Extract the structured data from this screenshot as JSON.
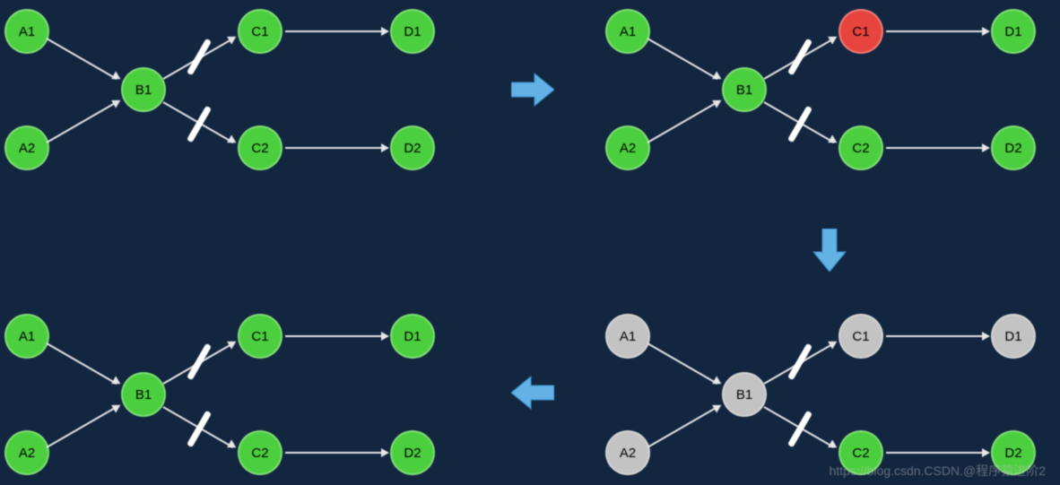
{
  "colors": {
    "green": "#4CCF3E",
    "red": "#E8443E",
    "gray": "#C3C3C3",
    "bg": "#122640",
    "arrow_blue": "#62B2E6"
  },
  "graphs": [
    {
      "id": "top-left",
      "nodes": {
        "A1": "green",
        "A2": "green",
        "B1": "green",
        "C1": "green",
        "C2": "green",
        "D1": "green",
        "D2": "green"
      }
    },
    {
      "id": "top-right",
      "nodes": {
        "A1": "green",
        "A2": "green",
        "B1": "green",
        "C1": "red",
        "C2": "green",
        "D1": "green",
        "D2": "green"
      }
    },
    {
      "id": "bottom-right",
      "nodes": {
        "A1": "gray",
        "A2": "gray",
        "B1": "gray",
        "C1": "gray",
        "C2": "green",
        "D1": "gray",
        "D2": "green"
      }
    },
    {
      "id": "bottom-left",
      "nodes": {
        "A1": "green",
        "A2": "green",
        "B1": "green",
        "C1": "green",
        "C2": "green",
        "D1": "green",
        "D2": "green"
      }
    }
  ],
  "node_labels": {
    "A1": "A1",
    "A2": "A2",
    "B1": "B1",
    "C1": "C1",
    "C2": "C2",
    "D1": "D1",
    "D2": "D2"
  },
  "flow_arrows": [
    "right",
    "down",
    "left"
  ],
  "watermark": "https://blog.csdn.CSDN.@程序猿进阶2"
}
